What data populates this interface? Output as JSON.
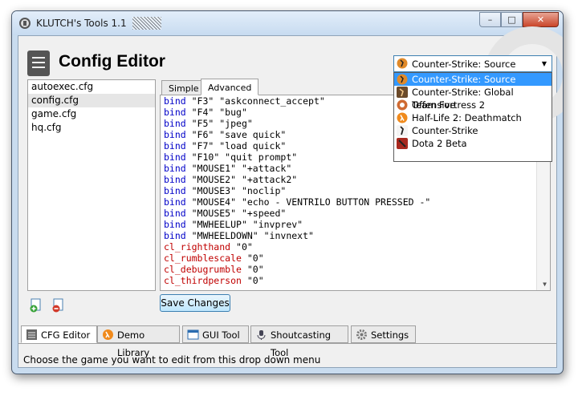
{
  "window": {
    "title": "KLUTCH's Tools 1.1"
  },
  "header": {
    "title": "Config Editor"
  },
  "files": [
    "autoexec.cfg",
    "config.cfg",
    "game.cfg",
    "hq.cfg"
  ],
  "selected_file": "config.cfg",
  "editor_tabs": [
    {
      "label": "Simple"
    },
    {
      "label": "Advanced"
    }
  ],
  "code_lines": [
    {
      "a": "bind",
      "b": " \"F3\" \"askconnect_accept\""
    },
    {
      "a": "bind",
      "b": " \"F4\" \"bug\""
    },
    {
      "a": "bind",
      "b": " \"F5\" \"jpeg\""
    },
    {
      "a": "bind",
      "b": " \"F6\" \"save quick\""
    },
    {
      "a": "bind",
      "b": " \"F7\" \"load quick\""
    },
    {
      "a": "bind",
      "b": " \"F10\" \"quit prompt\""
    },
    {
      "a": "bind",
      "b": " \"MOUSE1\" \"+attack\""
    },
    {
      "a": "bind",
      "b": " \"MOUSE2\" \"+attack2\""
    },
    {
      "a": "bind",
      "b": " \"MOUSE3\" \"noclip\""
    },
    {
      "a": "bind",
      "b": " \"MOUSE4\" \"echo - VENTRILO BUTTON PRESSED -\""
    },
    {
      "a": "bind",
      "b": " \"MOUSE5\" \"+speed\""
    },
    {
      "a": "bind",
      "b": " \"MWHEELUP\" \"invprev\""
    },
    {
      "a": "bind",
      "b": " \"MWHEELDOWN\" \"invnext\""
    },
    {
      "a": "cl_righthand",
      "b": " \"0\""
    },
    {
      "a": "cl_rumblescale",
      "b": " \"0\""
    },
    {
      "a": "cl_debugrumble",
      "b": " \"0\""
    },
    {
      "a": "cl_thirdperson",
      "b": " \"0\""
    }
  ],
  "save_button": "Save Changes",
  "bottom_tabs": [
    {
      "label": "CFG Editor"
    },
    {
      "label": "Demo Library"
    },
    {
      "label": "GUI Tool"
    },
    {
      "label": "Shoutcasting Tool"
    },
    {
      "label": "Settings"
    }
  ],
  "status_text": "Choose the game you want to edit from this drop down menu",
  "game_select": {
    "selected": "Counter-Strike: Source",
    "options": [
      "Counter-Strike: Source",
      "Counter-Strike: Global Offensive",
      "Team Fortress 2",
      "Half-Life 2: Deathmatch",
      "Counter-Strike",
      "Dota 2 Beta"
    ]
  },
  "colors": {
    "highlight": "#3399ff",
    "keyword": "#0000c8",
    "cvar": "#c00000"
  }
}
